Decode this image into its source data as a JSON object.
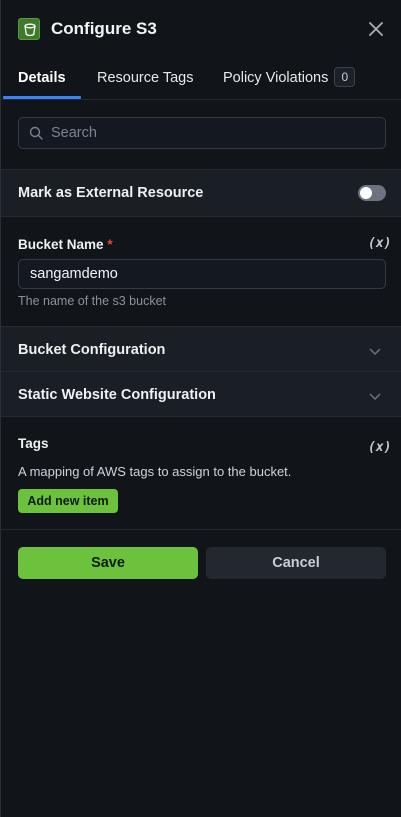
{
  "header": {
    "title": "Configure S3",
    "logo_icon": "aws-s3-bucket-icon",
    "close_icon": "close-icon"
  },
  "tabs": [
    {
      "label": "Details",
      "active": true
    },
    {
      "label": "Resource Tags",
      "active": false
    },
    {
      "label": "Policy Violations",
      "active": false,
      "badge": "0"
    }
  ],
  "search": {
    "placeholder": "Search",
    "value": ""
  },
  "external_resource": {
    "label": "Mark as External Resource",
    "enabled": false
  },
  "bucket_name": {
    "label": "Bucket Name",
    "required_marker": "*",
    "value": "sangamdemo",
    "help": "The name of the s3 bucket",
    "variable_icon": "(x)"
  },
  "sections": [
    {
      "label": "Bucket Configuration",
      "expanded": false
    },
    {
      "label": "Static Website Configuration",
      "expanded": false
    }
  ],
  "tags": {
    "label": "Tags",
    "variable_icon": "(x)",
    "description": "A mapping of AWS tags to assign to the bucket.",
    "add_label": "Add new item"
  },
  "footer": {
    "save_label": "Save",
    "cancel_label": "Cancel"
  },
  "colors": {
    "background": "#111419",
    "section_bg": "#1a1e25",
    "accent_green": "#6cc23c",
    "tab_underline": "#3b82f6",
    "required": "#ef4444"
  }
}
